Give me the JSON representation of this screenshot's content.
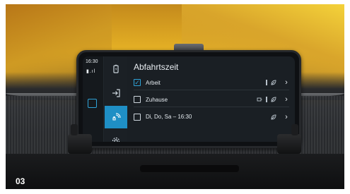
{
  "image_label": "03",
  "phone": {
    "status": {
      "time": "16:30"
    },
    "nav": [
      {
        "name": "battery",
        "icon": "battery-icon",
        "active": false
      },
      {
        "name": "login",
        "icon": "arrow-in-icon",
        "active": false
      },
      {
        "name": "charging",
        "icon": "plug-icon",
        "active": true
      },
      {
        "name": "service",
        "icon": "gear-icon",
        "active": false
      }
    ],
    "screen": {
      "title": "Abfahrtszeit",
      "rows": [
        {
          "label": "Arbeit",
          "checked": true,
          "icons": [
            "bar-icon",
            "leaf-icon"
          ]
        },
        {
          "label": "Zuhause",
          "checked": false,
          "icons": [
            "plug-small-icon",
            "bar-icon",
            "leaf-icon"
          ]
        },
        {
          "label": "Di, Do, Sa – 16:30",
          "checked": false,
          "icons": [
            "leaf-icon"
          ]
        }
      ]
    }
  },
  "colors": {
    "accent": "#1f8fc5",
    "check": "#2fa3d8",
    "screen_bg": "#1a1f24"
  }
}
